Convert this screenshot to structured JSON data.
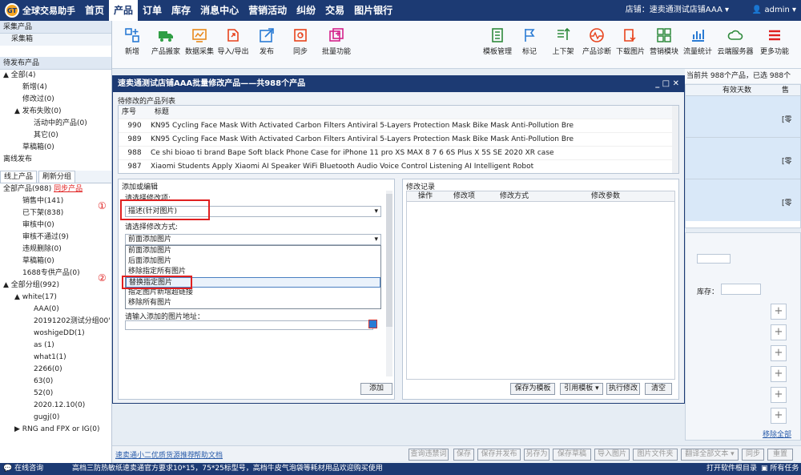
{
  "app": {
    "title": "全球交易助手"
  },
  "nav": [
    "首页",
    "产品",
    "订单",
    "库存",
    "消息中心",
    "营销活动",
    "纠纷",
    "交易",
    "图片银行"
  ],
  "shop_label": "店铺：速卖通测试店铺AAA ▾",
  "user_label": "admin ▾",
  "toolbar_left": [
    "新增",
    "产品搬家",
    "数据采集",
    "导入/导出",
    "发布",
    "同步",
    "批量功能"
  ],
  "toolbar_right": [
    "模板管理",
    "标记",
    "上下架",
    "产品诊断",
    "下载图片",
    "营销模块",
    "流量统计",
    "云端服务器",
    "更多功能"
  ],
  "sidebar": {
    "section1": "采集产品",
    "s1_item": "采集箱",
    "section2": "待发布产品",
    "tree1": [
      "▲ 全部(4)",
      "新增(4)",
      "修改过(0)",
      "▲ 发布失败(0)",
      "活动中的产品(0)",
      "其它(0)",
      "草稿箱(0)"
    ],
    "offline": "离线发布",
    "tab_online": "线上产品",
    "tab_refresh": "刷新分组",
    "all_products": "全部产品(988)",
    "sync_link": "同步产品",
    "tree2": [
      "销售中(141)",
      "已下架(838)",
      "审核中(0)",
      "审核不通过(9)",
      "违规删除(0)",
      "草稿箱(0)",
      "1688专供产品(0)"
    ],
    "groups_title": "▲ 全部分组(992)",
    "white": "▲ white(17)",
    "group_items": [
      "AAA(0)",
      "20191202测试分组00'",
      "woshigeDD(1)",
      "as (1)",
      "what1(1)",
      "2266(0)",
      "63(0)",
      "52(0)",
      "2020.12.10(0)",
      "gugj(0)"
    ],
    "rng": "▶ RNG and FPX or IG(0)"
  },
  "bg": {
    "count_text": "当前共 988个产品，已选 988个",
    "col_days": "有效天数",
    "col_cut": "售",
    "row_tag": "[零"
  },
  "dialog": {
    "title": "速卖通测试店铺AAA批量修改产品——共988个产品",
    "list_title": "待修改的产品列表",
    "col_no": "序号",
    "col_title": "标题",
    "rows": [
      {
        "no": "990",
        "title": "KN95 Cycling Face Mask With Activated Carbon Filters Antiviral 5-Layers Protection Mask Bike Mask Anti-Pollution Bre"
      },
      {
        "no": "989",
        "title": "KN95 Cycling Face Mask With Activated Carbon Filters Antiviral 5-Layers Protection Mask Bike Mask Anti-Pollution Bre"
      },
      {
        "no": "988",
        "title": "Ce shi bioao ti brand Bape Soft black Phone Case for iPhone 11 pro XS MAX 8 7 6 6S Plus X 5S SE 2020 XR case"
      },
      {
        "no": "987",
        "title": "Xiaomi Students Apply Xiaomi AI Speaker WiFi Bluetooth Audio Voice Control Listening AI Intelligent Robot"
      }
    ],
    "edit_title": "添加或编辑",
    "select_item_label": "请选择修改项:",
    "select_item_value": "描述(针对图片)",
    "select_mode_label": "请选择修改方式:",
    "select_mode_value": "前面添加图片",
    "mode_options": [
      "前面添加图片",
      "后面添加图片",
      "移除指定所有图片",
      "替换指定图片",
      "指定图片新增超链接",
      "移除所有图片"
    ],
    "url_label": "请输入添加的图片地址：",
    "add_btn": "添加",
    "log_title": "修改记录",
    "log_cols": [
      "操作",
      "修改项",
      "修改方式",
      "修改参数"
    ],
    "btn_save_tpl": "保存为模板",
    "btn_ref_tpl": "引用模板 ▾",
    "btn_exec": "执行修改",
    "btn_clear": "清空"
  },
  "marks": {
    "one": "①",
    "two": "②"
  },
  "right_panel": {
    "stock": "库存：",
    "remove_all": "移除全部"
  },
  "bottom": {
    "link1": "速卖通小二优质货源推荐",
    "link2": "帮助文档",
    "buttons": [
      "查询违禁词",
      "保存",
      "保存并发布",
      "另存为",
      "保存草稿",
      "导入图片",
      "图片文件夹",
      "翻译全部文本 ▾",
      "同步",
      "重置"
    ]
  },
  "status": {
    "left": "在线咨询",
    "ticker": "高档三防热敏纸速卖通官方要求10*15，75*25标型号，高档牛皮气泡袋等耗材用品欢迎购买使用",
    "right1": "打开软件根目录",
    "right2": "所有任务"
  }
}
